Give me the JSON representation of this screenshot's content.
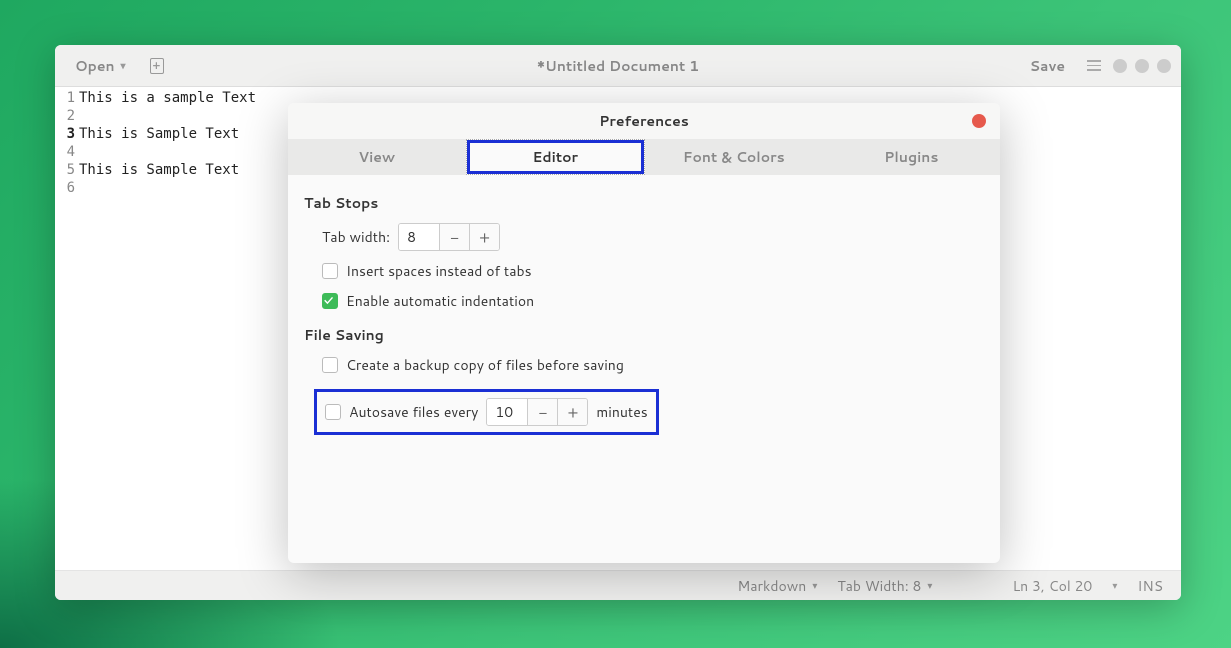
{
  "header": {
    "open_label": "Open",
    "title": "*Untitled Document 1",
    "save_label": "Save"
  },
  "editor": {
    "lines": [
      "This is a sample Text",
      "",
      "This is Sample Text",
      "",
      "This is Sample Text",
      ""
    ],
    "current_line": 3
  },
  "statusbar": {
    "syntax": "Markdown",
    "tab_width": "Tab Width: 8",
    "position": "Ln 3, Col 20",
    "mode": "INS"
  },
  "prefs": {
    "title": "Preferences",
    "tabs": {
      "view": "View",
      "editor": "Editor",
      "fonts": "Font & Colors",
      "plugins": "Plugins"
    },
    "active_tab": "editor",
    "tab_stops": {
      "section": "Tab Stops",
      "tab_width_label": "Tab width:",
      "tab_width_value": "8",
      "insert_spaces_label": "Insert spaces instead of tabs",
      "insert_spaces_checked": false,
      "auto_indent_label": "Enable automatic indentation",
      "auto_indent_checked": true
    },
    "file_saving": {
      "section": "File Saving",
      "backup_label": "Create a backup copy of files before saving",
      "backup_checked": false,
      "autosave_label": "Autosave files every",
      "autosave_value": "10",
      "autosave_suffix": "minutes",
      "autosave_checked": false
    }
  }
}
